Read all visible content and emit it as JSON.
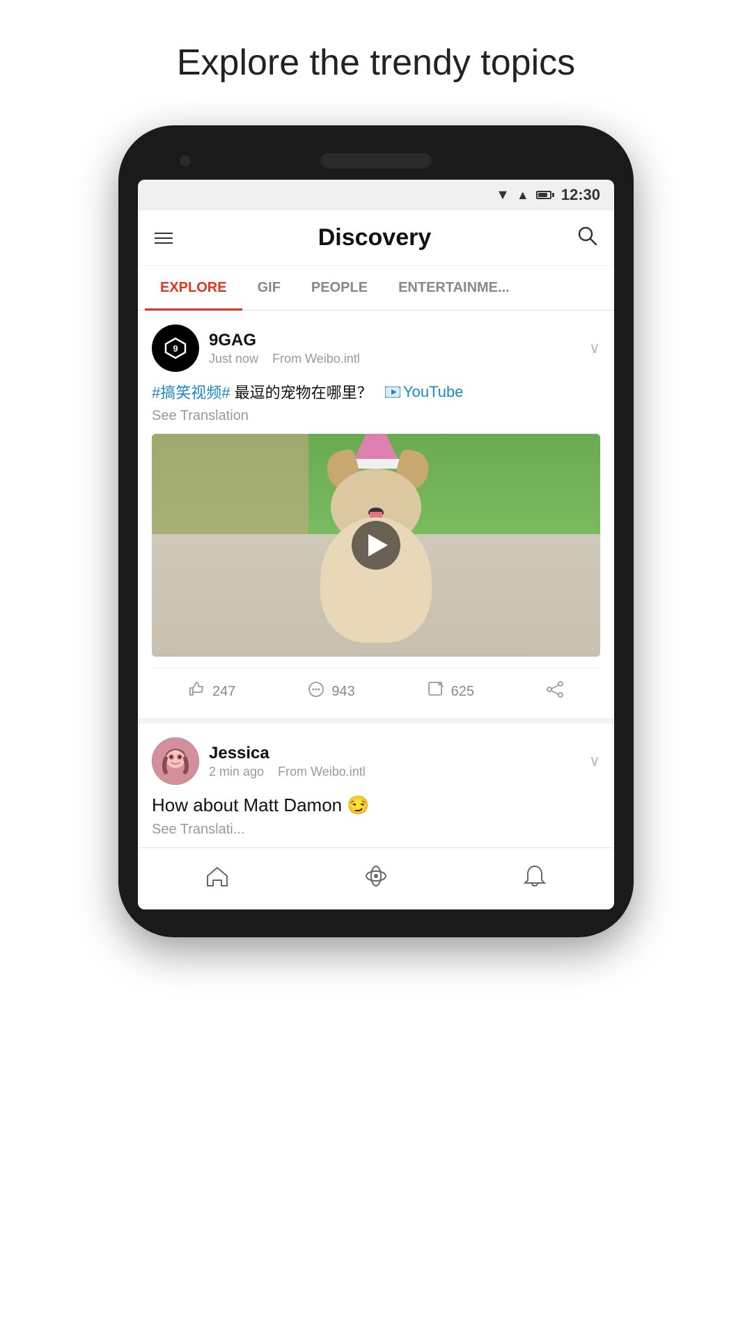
{
  "page": {
    "title": "Explore the trendy topics"
  },
  "status_bar": {
    "time": "12:30"
  },
  "header": {
    "title": "Discovery",
    "menu_label": "Menu",
    "search_label": "Search"
  },
  "tabs": [
    {
      "id": "explore",
      "label": "EXPLORE",
      "active": true
    },
    {
      "id": "gif",
      "label": "GIF",
      "active": false
    },
    {
      "id": "people",
      "label": "PEOPLE",
      "active": false
    },
    {
      "id": "entertainment",
      "label": "ENTERTAINME...",
      "active": false
    }
  ],
  "posts": [
    {
      "id": "post1",
      "author": {
        "name": "9GAG",
        "avatar_type": "9gag",
        "time": "Just now",
        "source": "From Weibo.intl"
      },
      "content": {
        "hashtag": "#搞笑视频#",
        "text": " 最逗的宠物在哪里？",
        "youtube_text": "YouTube",
        "see_translation": "See Translation"
      },
      "actions": {
        "likes": "247",
        "comments": "943",
        "shares": "625"
      }
    },
    {
      "id": "post2",
      "author": {
        "name": "Jessica",
        "avatar_type": "jessica",
        "time": "2 min ago",
        "source": "From Weibo.intl"
      },
      "content": {
        "text": "How about Matt Damon 😏",
        "see_translation": "See Translati..."
      }
    }
  ],
  "bottom_nav": [
    {
      "id": "home",
      "icon": "🏠",
      "label": "Home"
    },
    {
      "id": "discover",
      "icon": "🪐",
      "label": "Discover"
    },
    {
      "id": "notifications",
      "icon": "🔔",
      "label": "Notifications"
    }
  ],
  "colors": {
    "accent_red": "#e8321c",
    "tab_active": "#e8321c",
    "hashtag_blue": "#1a88c9",
    "link_blue": "#1a88c9"
  }
}
